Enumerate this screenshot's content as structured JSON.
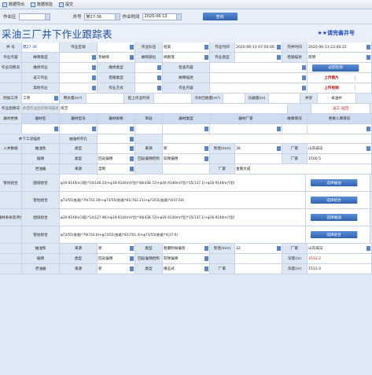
{
  "toolbar": {
    "export_label": "数据导出",
    "check_label": "数据校验",
    "submit_label": "提交"
  },
  "filter": {
    "zone_label": "作业区",
    "zone_value": "",
    "well_label": "井号",
    "well_value": "樊27-36",
    "date_label": "作业时间",
    "date_value": "2020-06-13",
    "query_label": "查询"
  },
  "title": "采油三厂井下作业跟踪表",
  "title_right": "★★请完善井号",
  "rows": [
    [
      "井    号",
      "樊27-36",
      "作业区域",
      "",
      "作业队伍",
      "桩第",
      "作业时间",
      "2020-06-13 07:00:00",
      "完井时间",
      "2020-06-13 22:00:22"
    ],
    [
      "作业内容",
      "故障类型",
      "",
      "泵故障",
      "故障部位",
      "阀脱落",
      "作业类型",
      "",
      "措施描述",
      "",
      "简明"
    ],
    [
      "作业前情况",
      "维修作业",
      "",
      "维修类型",
      "",
      "检查内容",
      "",
      "",
      "返回检测"
    ],
    [
      "",
      "返工作业",
      "",
      "措施类型",
      "",
      "故障描述",
      "",
      "",
      "上传图片"
    ],
    [
      "",
      "其他作业",
      "",
      "作业方式",
      "",
      "作业内容",
      "",
      "",
      "上传视频"
    ],
    [
      "附加工序",
      "工序",
      "",
      "用水量(m³)",
      "",
      "起上作业时间",
      "",
      "污水回收量(m³)",
      "",
      "仪器量(m)",
      "",
      "井架",
      "采油井"
    ],
    [
      "作业后情况",
      "承诺作业后的情况描述",
      "",
      "简洁",
      "",
      "",
      "返工  返回"
    ],
    [
      "器材更换",
      "器材名",
      "器材型号",
      "器材规格",
      "单层",
      "器材类型",
      "器材厂家",
      "",
      "故障情况",
      "更换入库情况"
    ]
  ],
  "section": {
    "downhole": "井下工况描述",
    "tubing_open": "抽油杆开孔",
    "pipe_up": "管柱组合",
    "entry_data": "入井数据",
    "assess": "器材寿命及评价"
  },
  "detail": [
    [
      "抽油泵",
      "类型",
      "",
      "来源",
      "新",
      "泵径(mm)",
      "38",
      "厂家",
      "山东威马"
    ],
    [
      "偏颈",
      "类型",
      "回返偏颈",
      "回返偏颈结构",
      "软球偏颈",
      "",
      "",
      "厂家",
      "1500.5"
    ],
    [
      "泄油器",
      "来源",
      "自制",
      "",
      "",
      "厂家",
      "金隆文成"
    ],
    [
      "图纸组合",
      "φ19-9140m(3套)*16(146.24)+φ19-9140m(Y型)*48(438.72)+φ16-9140m(Y型)*15(137.1)+φ16-9140m(Y型)",
      "选择抽油"
    ],
    [
      "管柱组合",
      "φ73/55(普通)*79(743.39)+φ73/55(普通)*81(762.21)+φ73/55(普通)*4(37.64)",
      "选择组合"
    ],
    [
      "图纸组合",
      "φ19-9140m(3套)*14(127.96)+φ19-9140m(Y型)*48(438.72)+φ16-9140m(Y型)*15(137.1)+φ16-9140m(Y型)",
      "选择抽油"
    ],
    [
      "管柱组合",
      "φ73/55(普通)*79(742.6)+φ73/55(普通)*81(761.4)+φ73/55(普通)*4(37.6)",
      "选择组合"
    ],
    [
      "抽油泵",
      "来源",
      "新",
      "类型",
      "耐磨防垢偏泵",
      "泵径(mm)",
      "32",
      "厂家",
      "山东威马"
    ],
    [
      "偏颈",
      "类型",
      "回返偏颈",
      "回返偏颈结构",
      "软球偏颈",
      "",
      "",
      "深度(m)",
      "1512.2"
    ],
    [
      "泄油器",
      "来源",
      "新",
      "类型",
      "撞击式",
      "厂家",
      "",
      "深度(m)",
      "1512.4"
    ]
  ]
}
